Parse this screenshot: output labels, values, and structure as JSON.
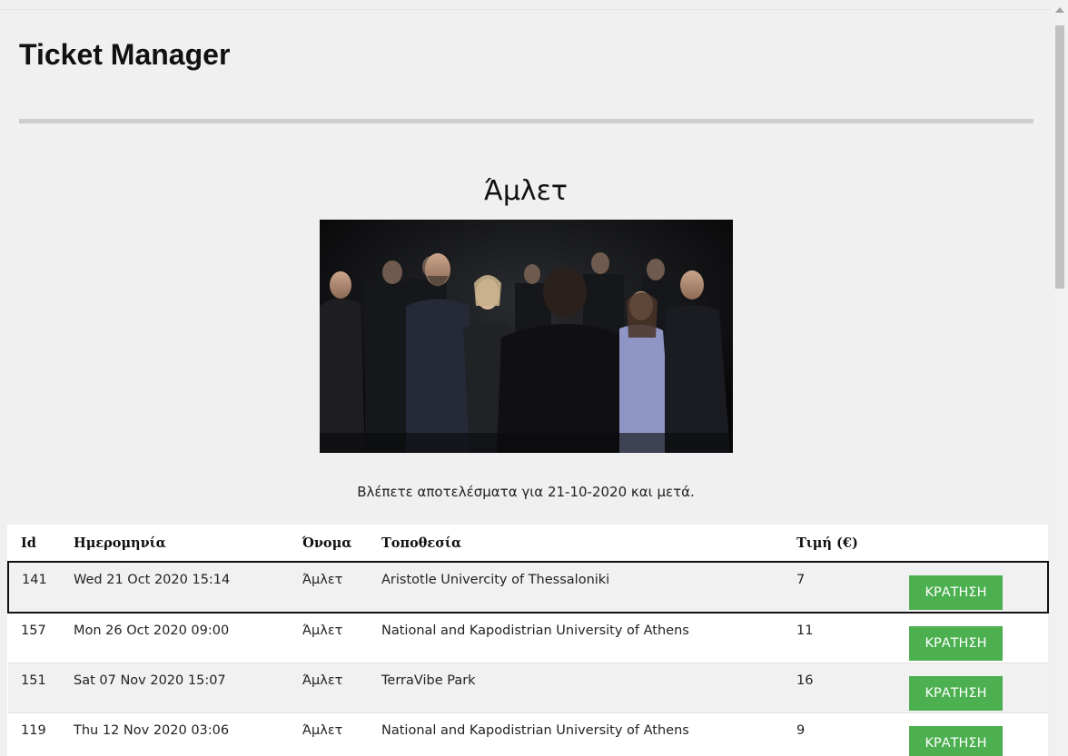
{
  "app": {
    "title": "Ticket Manager"
  },
  "show": {
    "title": "Άμλετ",
    "results_note": "Βλέπετε αποτελέσματα για 21-10-2020 και μετά."
  },
  "table": {
    "headers": [
      "Id",
      "Ημερομηνία",
      "Όνομα",
      "Τοποθεσία",
      "Τιμή (€)",
      ""
    ],
    "rows": [
      {
        "id": "141",
        "date": "Wed 21 Oct 2020 15:14",
        "name": "Άμλετ",
        "location": "Aristotle Univercity of Thessaloniki",
        "price": "7",
        "action": "ΚΡΑΤΗΣΗ"
      },
      {
        "id": "157",
        "date": "Mon 26 Oct 2020 09:00",
        "name": "Άμλετ",
        "location": "National and Kapodistrian University of Athens",
        "price": "11",
        "action": "ΚΡΑΤΗΣΗ"
      },
      {
        "id": "151",
        "date": "Sat 07 Nov 2020 15:07",
        "name": "Άμλετ",
        "location": "TerraVibe Park",
        "price": "16",
        "action": "ΚΡΑΤΗΣΗ"
      },
      {
        "id": "119",
        "date": "Thu 12 Nov 2020 03:06",
        "name": "Άμλετ",
        "location": "National and Kapodistrian University of Athens",
        "price": "9",
        "action": "ΚΡΑΤΗΣΗ"
      }
    ]
  },
  "colors": {
    "page_background": "#f0f0f0",
    "divider": "#cdcdcd",
    "button": "#4caf50",
    "button_text": "#ffffff"
  },
  "icons": {
    "scroll_up": "scroll-up-arrow-icon"
  }
}
